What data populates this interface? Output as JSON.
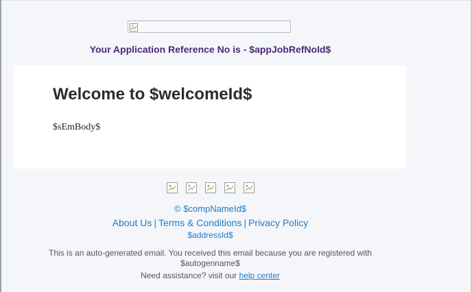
{
  "header": {
    "logo_icon": "broken-image-icon",
    "reference_text": "Your Application Reference No is - $appJobRefNoId$"
  },
  "card": {
    "heading": "Welcome to $welcomeId$",
    "body": "$sEmBody$"
  },
  "social": {
    "icons": [
      "broken-image-icon",
      "broken-image-icon",
      "broken-image-icon",
      "broken-image-icon",
      "broken-image-icon"
    ]
  },
  "footer": {
    "copyright": "© $compNameId$",
    "links": {
      "about": "About Us",
      "terms": "Terms & Conditions",
      "privacy": "Privacy Policy",
      "separator": "|"
    },
    "address": "$addressId$",
    "notice_line1": "This is an auto-generated email. You received this email because you are registered with",
    "notice_line2": "$autogenname$",
    "assist_prefix": "Need assistance? visit our",
    "assist_link": "help center"
  },
  "colors": {
    "reference": "#4b2a73",
    "link": "#1e7bc4",
    "background": "#f4f6fa",
    "card": "#ffffff"
  }
}
